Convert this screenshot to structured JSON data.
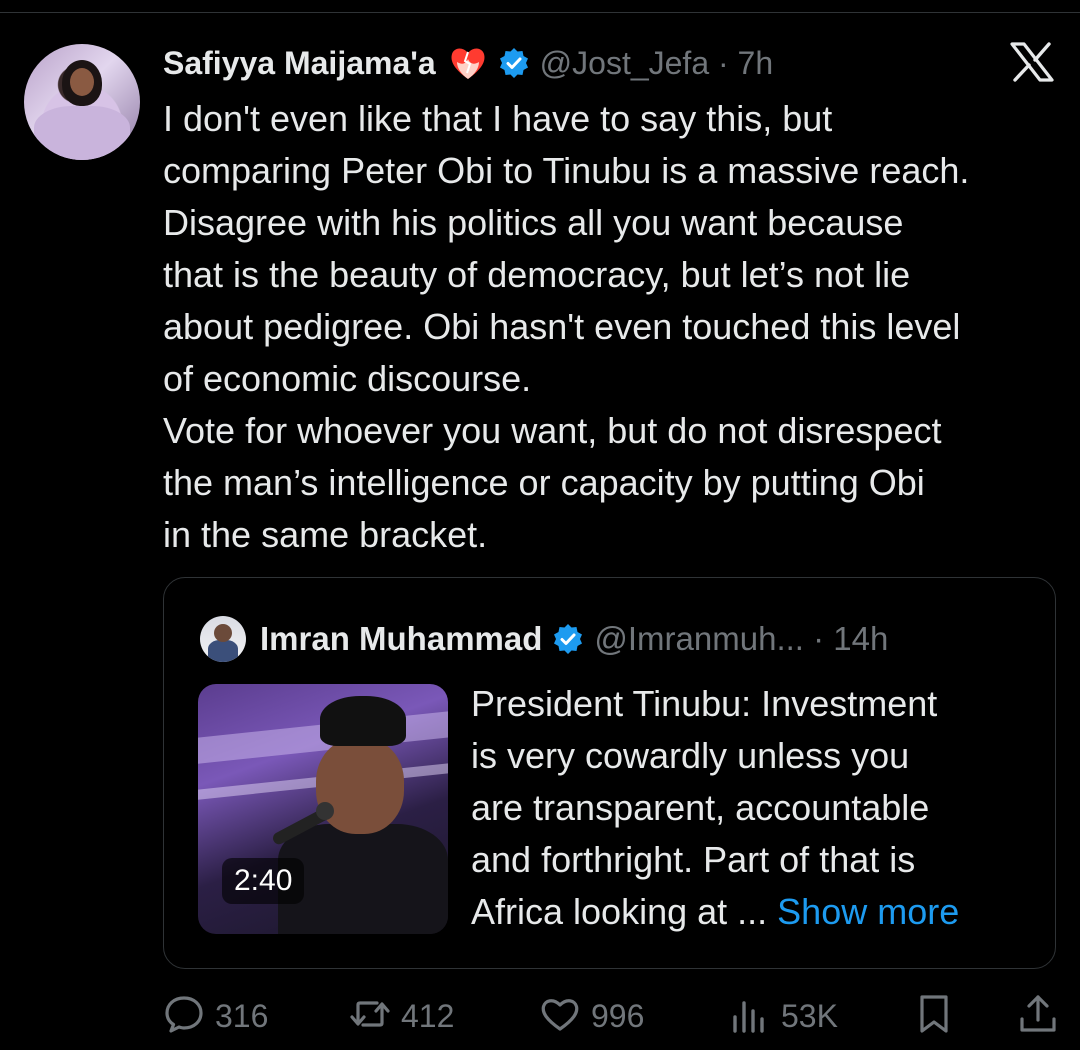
{
  "tweet": {
    "author_name": "Safiyya Maijama'a",
    "handle_time": "@Jost_Jefa · 7h",
    "text": "I don't even like that I have to say this, but\ncomparing Peter Obi to Tinubu is a massive reach.\nDisagree with his politics all you want because\nthat is the beauty of democracy, but let’s not lie\nabout pedigree. Obi hasn't even touched this level\nof economic discourse.\nVote for whoever you want, but do not disrespect\nthe man’s intelligence or capacity by putting Obi\nin the same bracket."
  },
  "quote": {
    "author_name": "Imran Muhammad",
    "handle_time": "@Imranmuh... · 14h",
    "text_lines": [
      "President Tinubu: Investment",
      "is very cowardly unless you",
      "are transparent, accountable",
      "and forthright. Part of that is",
      "Africa looking at ..."
    ],
    "show_more": "Show more",
    "video_duration": "2:40"
  },
  "actions": {
    "replies": "316",
    "reposts": "412",
    "likes": "996",
    "views": "53K"
  },
  "icons": {
    "emoji": "mending-heart-emoji",
    "verified": "verified-badge-icon",
    "x_logo": "x-logo-icon",
    "reply": "reply-icon",
    "repost": "repost-icon",
    "like": "heart-icon",
    "views": "views-icon",
    "bookmark": "bookmark-icon",
    "share": "share-icon"
  },
  "colors": {
    "background": "#000000",
    "text": "#e7e9ea",
    "secondary": "#71767b",
    "link": "#1d9bf0",
    "verified": "#1d9bf0",
    "border": "#2f3336"
  }
}
